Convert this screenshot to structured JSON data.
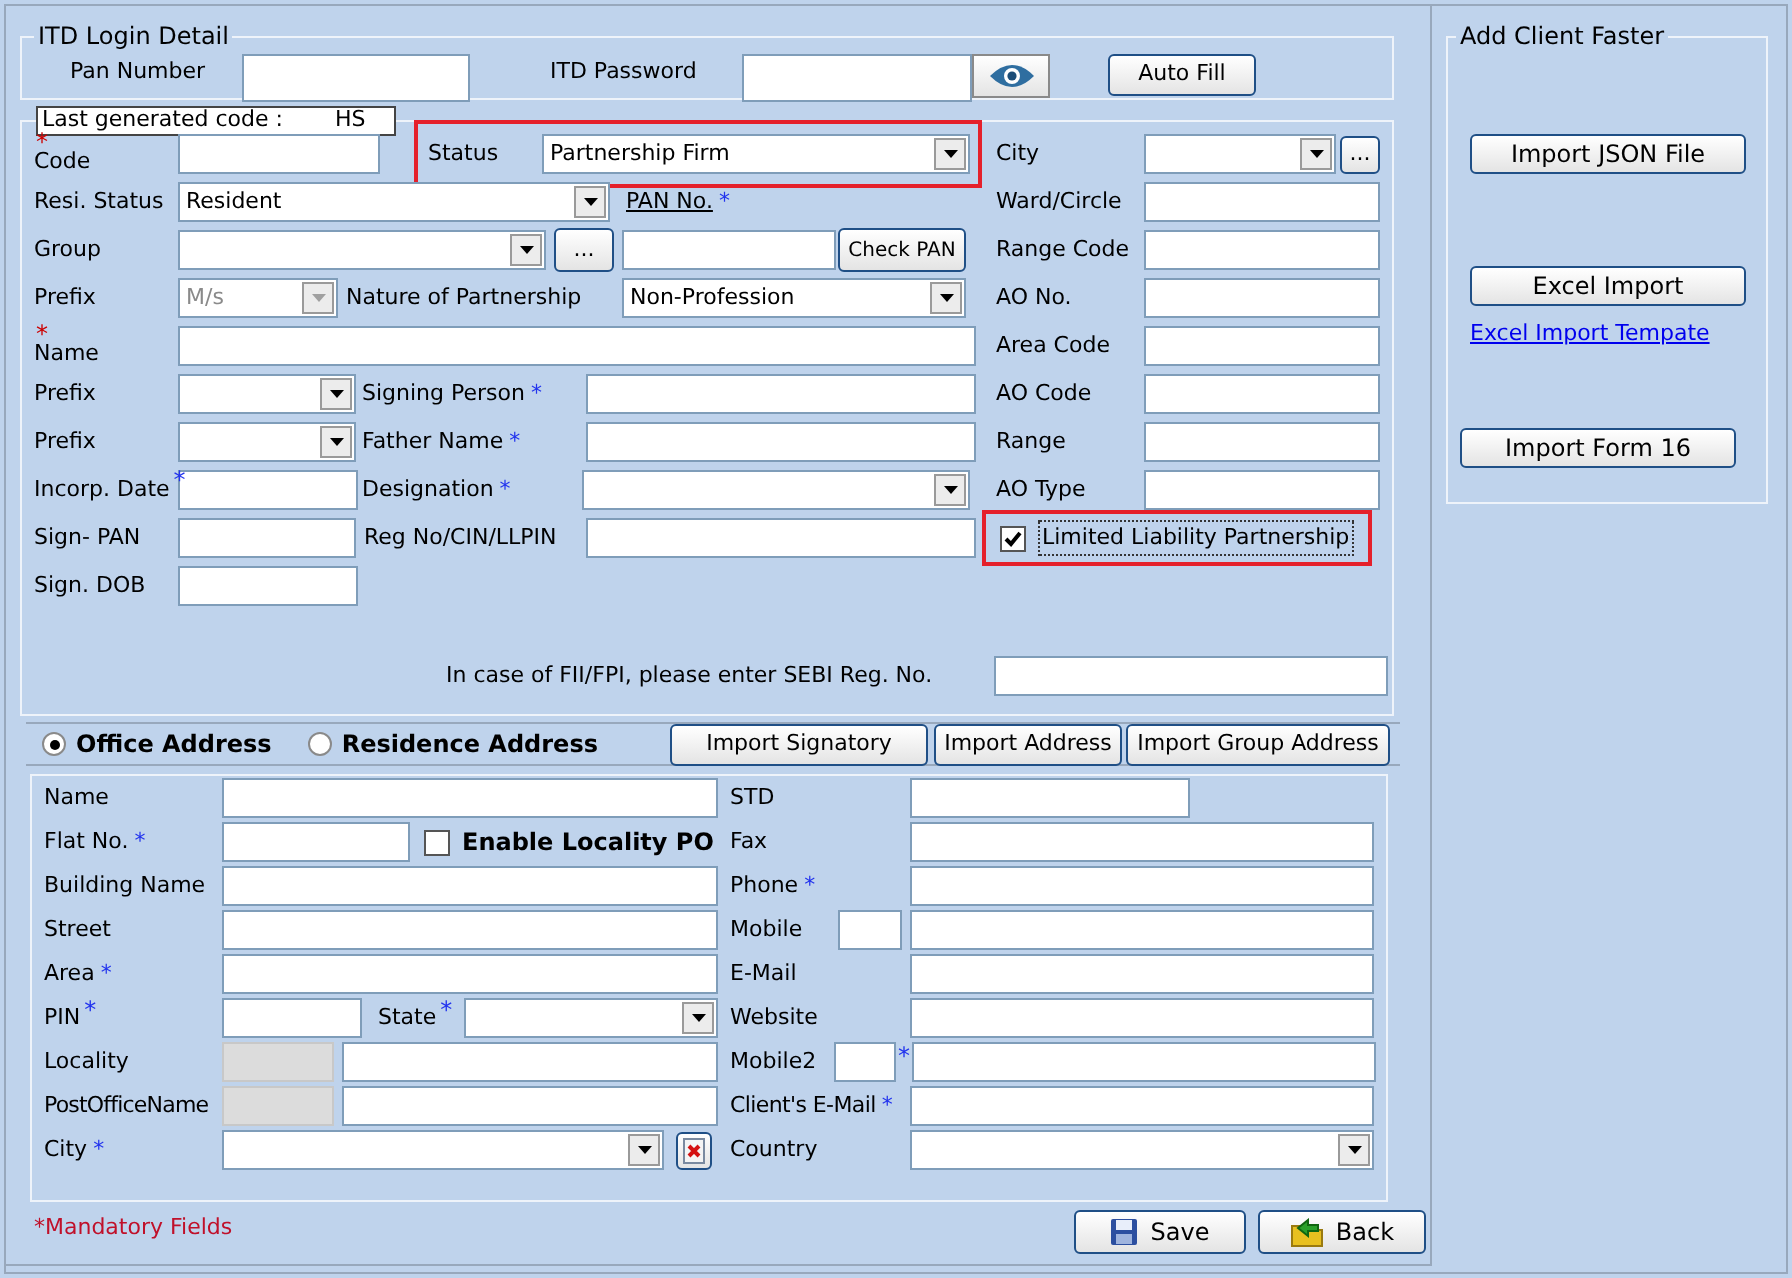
{
  "itd_login": {
    "title": "ITD Login Detail",
    "fields": [
      {
        "label": "Pan Number",
        "kind": "text"
      },
      {
        "label": "ITD Password",
        "kind": "password"
      }
    ],
    "button": "Auto Fill"
  },
  "last_generated_code": {
    "label": "Last generated code :",
    "value": "HS"
  },
  "client_form": {
    "left_rows": [
      [
        {
          "kind": "label",
          "text": "Code",
          "star": {
            "text": "*",
            "color": "#cc0000",
            "above": true,
            "raised": false
          }
        },
        {
          "kind": "text"
        },
        {
          "kind": "labeled_select",
          "label": "Status",
          "value": "Partnership Firm",
          "disabled": false,
          "highlighted": true
        }
      ],
      [
        {
          "kind": "label",
          "text": "Resi. Status"
        },
        {
          "kind": "select",
          "value": "Resident",
          "disabled": false
        },
        {
          "kind": "link",
          "text": "PAN No.",
          "star": {
            "text": "*",
            "color": "#2233ee",
            "above": false,
            "raised": false
          }
        }
      ],
      [
        {
          "kind": "label",
          "text": "Group"
        },
        {
          "kind": "select",
          "disabled": false
        },
        {
          "kind": "button",
          "text": "..."
        },
        {
          "kind": "text"
        },
        {
          "kind": "button",
          "text": "Check PAN"
        }
      ],
      [
        {
          "kind": "label",
          "text": "Prefix"
        },
        {
          "kind": "select",
          "value": "M/s",
          "disabled": true
        },
        {
          "kind": "label",
          "text": "Nature of Partnership"
        },
        {
          "kind": "select",
          "value": "Non-Profession",
          "disabled": false
        }
      ],
      [
        {
          "kind": "label",
          "text": "Name",
          "star": {
            "text": "*",
            "color": "#cc0000",
            "above": true,
            "raised": false
          }
        },
        {
          "kind": "text"
        }
      ],
      [
        {
          "kind": "label",
          "text": "Prefix"
        },
        {
          "kind": "select",
          "disabled": false
        },
        {
          "kind": "label",
          "text": "Signing Person",
          "star": {
            "text": "*",
            "color": "#2233ee",
            "above": false,
            "raised": false
          }
        },
        {
          "kind": "text"
        }
      ],
      [
        {
          "kind": "label",
          "text": "Prefix"
        },
        {
          "kind": "select",
          "disabled": false
        },
        {
          "kind": "label",
          "text": "Father Name",
          "star": {
            "text": "*",
            "color": "#2233ee",
            "above": false,
            "raised": false
          }
        },
        {
          "kind": "text"
        }
      ],
      [
        {
          "kind": "label",
          "text": "Incorp. Date",
          "star": {
            "text": "*",
            "color": "#2233ee",
            "above": false,
            "raised": true
          }
        },
        {
          "kind": "text"
        },
        {
          "kind": "label",
          "text": "Designation",
          "star": {
            "text": "*",
            "color": "#2233ee",
            "above": false,
            "raised": false
          }
        },
        {
          "kind": "select",
          "disabled": false
        }
      ],
      [
        {
          "kind": "label",
          "text": "Sign- PAN"
        },
        {
          "kind": "text"
        },
        {
          "kind": "label",
          "text": "Reg No/CIN/LLPIN"
        },
        {
          "kind": "text"
        }
      ],
      [
        {
          "kind": "label",
          "text": "Sign. DOB"
        },
        {
          "kind": "text"
        }
      ]
    ],
    "right_rows": [
      [
        {
          "kind": "label",
          "text": "City"
        },
        {
          "kind": "select",
          "disabled": false
        },
        {
          "kind": "button",
          "text": "..."
        }
      ],
      [
        {
          "kind": "label",
          "text": "Ward/Circle"
        },
        {
          "kind": "text"
        }
      ],
      [
        {
          "kind": "label",
          "text": "Range Code"
        },
        {
          "kind": "text"
        }
      ],
      [
        {
          "kind": "label",
          "text": "AO No."
        },
        {
          "kind": "text"
        }
      ],
      [
        {
          "kind": "label",
          "text": "Area Code"
        },
        {
          "kind": "text"
        }
      ],
      [
        {
          "kind": "label",
          "text": "AO Code"
        },
        {
          "kind": "text"
        }
      ],
      [
        {
          "kind": "label",
          "text": "Range"
        },
        {
          "kind": "text"
        }
      ],
      [
        {
          "kind": "label",
          "text": "AO Type"
        },
        {
          "kind": "text"
        }
      ],
      [
        {
          "kind": "checkbox",
          "label": "Limited Liability Partnership",
          "checked": true,
          "highlighted": true
        }
      ]
    ],
    "sebi_label": "In case of FII/FPI, please enter SEBI Reg. No."
  },
  "address": {
    "options": [
      {
        "label": "Office Address",
        "selected": true
      },
      {
        "label": "Residence Address",
        "selected": false
      }
    ],
    "buttons": [
      "Import Signatory",
      "Import Address",
      "Import Group Address"
    ],
    "left_rows": [
      [
        {
          "kind": "label",
          "text": "Name"
        },
        {
          "kind": "text"
        }
      ],
      [
        {
          "kind": "label",
          "text": "Flat No.",
          "star": {
            "text": "*",
            "color": "#2233ee",
            "above": false,
            "raised": false
          }
        },
        {
          "kind": "text"
        },
        {
          "kind": "checkbox",
          "label": "Enable Locality PO",
          "checked": false,
          "highlighted": false
        }
      ],
      [
        {
          "kind": "label",
          "text": "Building Name"
        },
        {
          "kind": "text"
        }
      ],
      [
        {
          "kind": "label",
          "text": "Street"
        },
        {
          "kind": "text"
        }
      ],
      [
        {
          "kind": "label",
          "text": "Area",
          "star": {
            "text": "*",
            "color": "#2233ee",
            "above": false,
            "raised": false
          }
        },
        {
          "kind": "text"
        }
      ],
      [
        {
          "kind": "label",
          "text": "PIN",
          "star": {
            "text": "*",
            "color": "#2233ee",
            "above": false,
            "raised": true
          }
        },
        {
          "kind": "text"
        },
        {
          "kind": "label",
          "text": "State",
          "star": {
            "text": "*",
            "color": "#2233ee",
            "above": false,
            "raised": true
          }
        },
        {
          "kind": "select",
          "disabled": false
        }
      ],
      [
        {
          "kind": "label",
          "text": "Locality"
        },
        {
          "kind": "readonly"
        },
        {
          "kind": "text"
        }
      ],
      [
        {
          "kind": "label",
          "text": "PostOfficeName"
        },
        {
          "kind": "readonly"
        },
        {
          "kind": "text"
        }
      ],
      [
        {
          "kind": "label",
          "text": "City",
          "star": {
            "text": "*",
            "color": "#2233ee",
            "above": false,
            "raised": false
          }
        },
        {
          "kind": "select",
          "disabled": false
        },
        {
          "kind": "icon_button"
        }
      ]
    ],
    "right_rows": [
      [
        {
          "kind": "label",
          "text": "STD"
        },
        {
          "kind": "text"
        }
      ],
      [
        {
          "kind": "label",
          "text": "Fax"
        },
        {
          "kind": "text"
        }
      ],
      [
        {
          "kind": "label",
          "text": "Phone",
          "star": {
            "text": "*",
            "color": "#2233ee",
            "above": false,
            "raised": false
          }
        },
        {
          "kind": "text"
        }
      ],
      [
        {
          "kind": "label",
          "text": "Mobile"
        },
        {
          "kind": "text"
        },
        {
          "kind": "text"
        }
      ],
      [
        {
          "kind": "label",
          "text": "E-Mail"
        },
        {
          "kind": "text"
        }
      ],
      [
        {
          "kind": "label",
          "text": "Website"
        },
        {
          "kind": "text"
        }
      ],
      [
        {
          "kind": "label",
          "text": "Mobile2"
        },
        {
          "kind": "text"
        },
        {
          "kind": "star",
          "text": "*",
          "color": "#2233ee"
        },
        {
          "kind": "text"
        }
      ],
      [
        {
          "kind": "label",
          "text": "Client's E-Mail",
          "star": {
            "text": "*",
            "color": "#2233ee",
            "above": false,
            "raised": false
          }
        },
        {
          "kind": "text"
        }
      ],
      [
        {
          "kind": "label",
          "text": "Country"
        },
        {
          "kind": "select",
          "disabled": false
        }
      ]
    ]
  },
  "add_client_faster": {
    "title": "Add Client Faster",
    "items": [
      {
        "kind": "button",
        "text": "Import JSON File"
      },
      {
        "kind": "button",
        "text": "Excel Import"
      },
      {
        "kind": "link",
        "text": "Excel Import Tempate"
      },
      {
        "kind": "button",
        "text": "Import Form 16"
      }
    ]
  },
  "footer": {
    "note": "*Mandatory Fields",
    "buttons": [
      {
        "kind": "save",
        "text": "Save"
      },
      {
        "kind": "back",
        "text": "Back"
      }
    ]
  }
}
